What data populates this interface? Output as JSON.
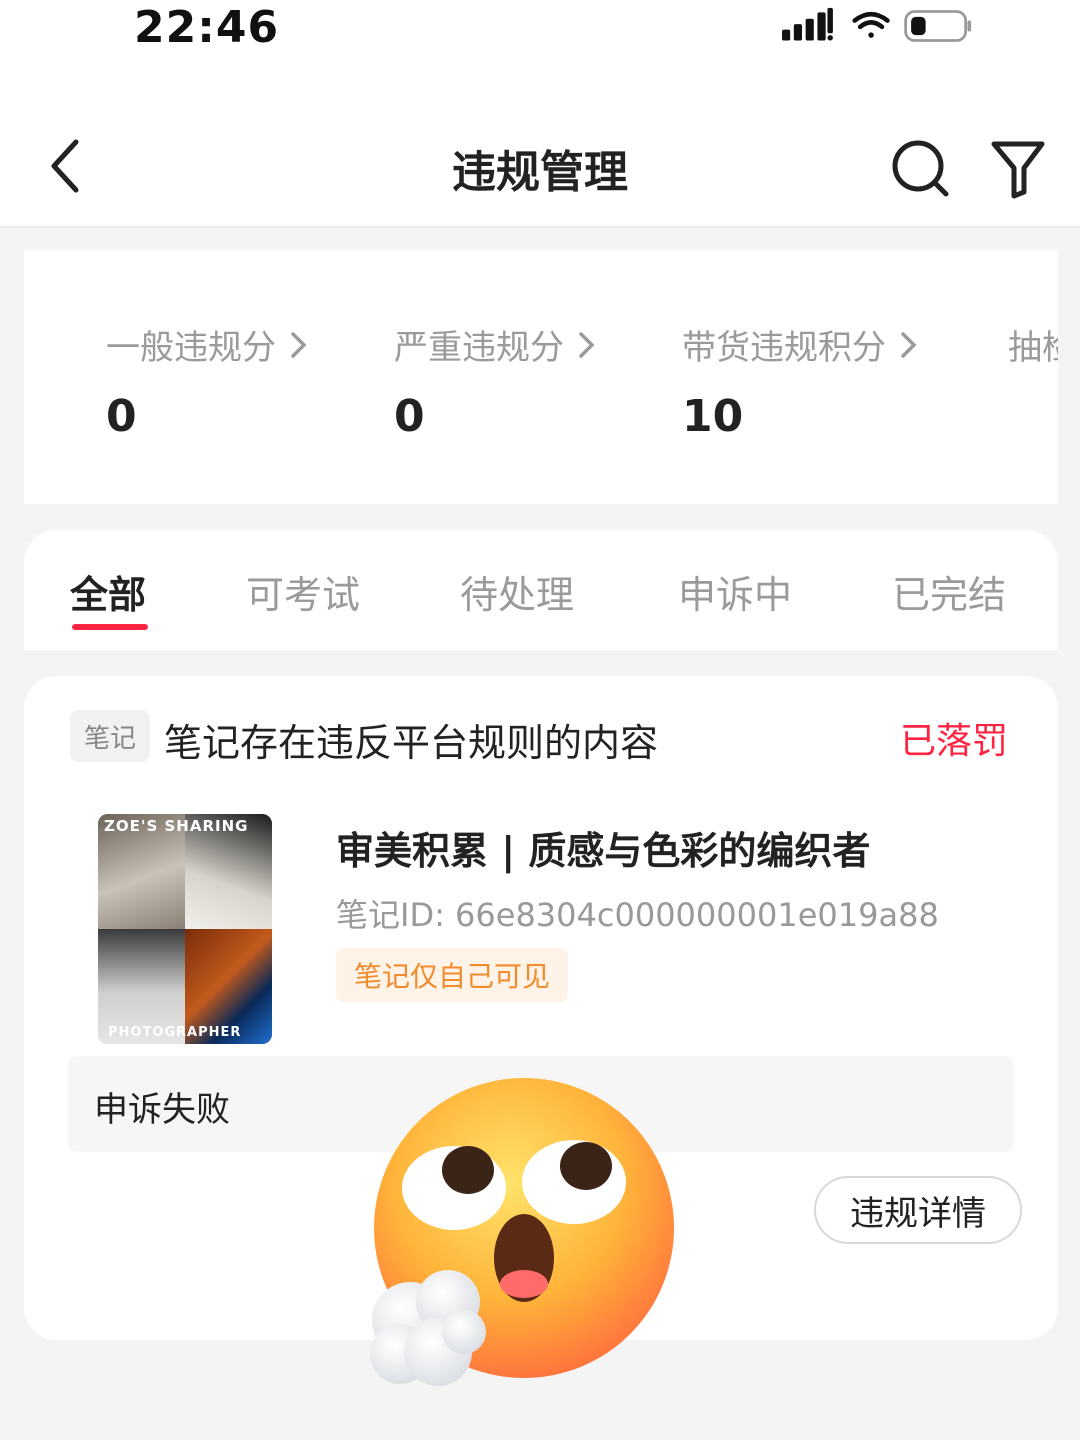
{
  "status_bar": {
    "time": "22:46"
  },
  "nav": {
    "title": "违规管理"
  },
  "scores": [
    {
      "label": "一般违规分",
      "value": "0"
    },
    {
      "label": "严重违规分",
      "value": "0"
    },
    {
      "label": "带货违规积分",
      "value": "10"
    },
    {
      "label": "抽检",
      "value": ""
    }
  ],
  "tabs": [
    {
      "label": "全部",
      "active": true
    },
    {
      "label": "可考试",
      "active": false
    },
    {
      "label": "待处理",
      "active": false
    },
    {
      "label": "申诉中",
      "active": false
    },
    {
      "label": "已完结",
      "active": false
    }
  ],
  "violation": {
    "type_badge": "笔记",
    "title": "笔记存在违反平台规则的内容",
    "status": "已落罚",
    "status_color": "#ff2442",
    "note": {
      "title": "审美积累 | 质感与色彩的编织者",
      "id": "笔记ID: 66e8304c000000001e019a88",
      "visibility": "笔记仅自己可见",
      "thumbnail_text_top": "ZOE'S SHARING",
      "thumbnail_text_bottom": "PHOTOGRAPHER"
    },
    "appeal_result": "申诉失败",
    "detail_button": "违规详情"
  },
  "accent_color": "#ff2442",
  "icons": [
    "back-arrow-icon",
    "search-icon",
    "filter-icon",
    "signal-icon",
    "wifi-icon",
    "battery-icon",
    "chevron-right-icon",
    "sighing-face-emoji"
  ]
}
